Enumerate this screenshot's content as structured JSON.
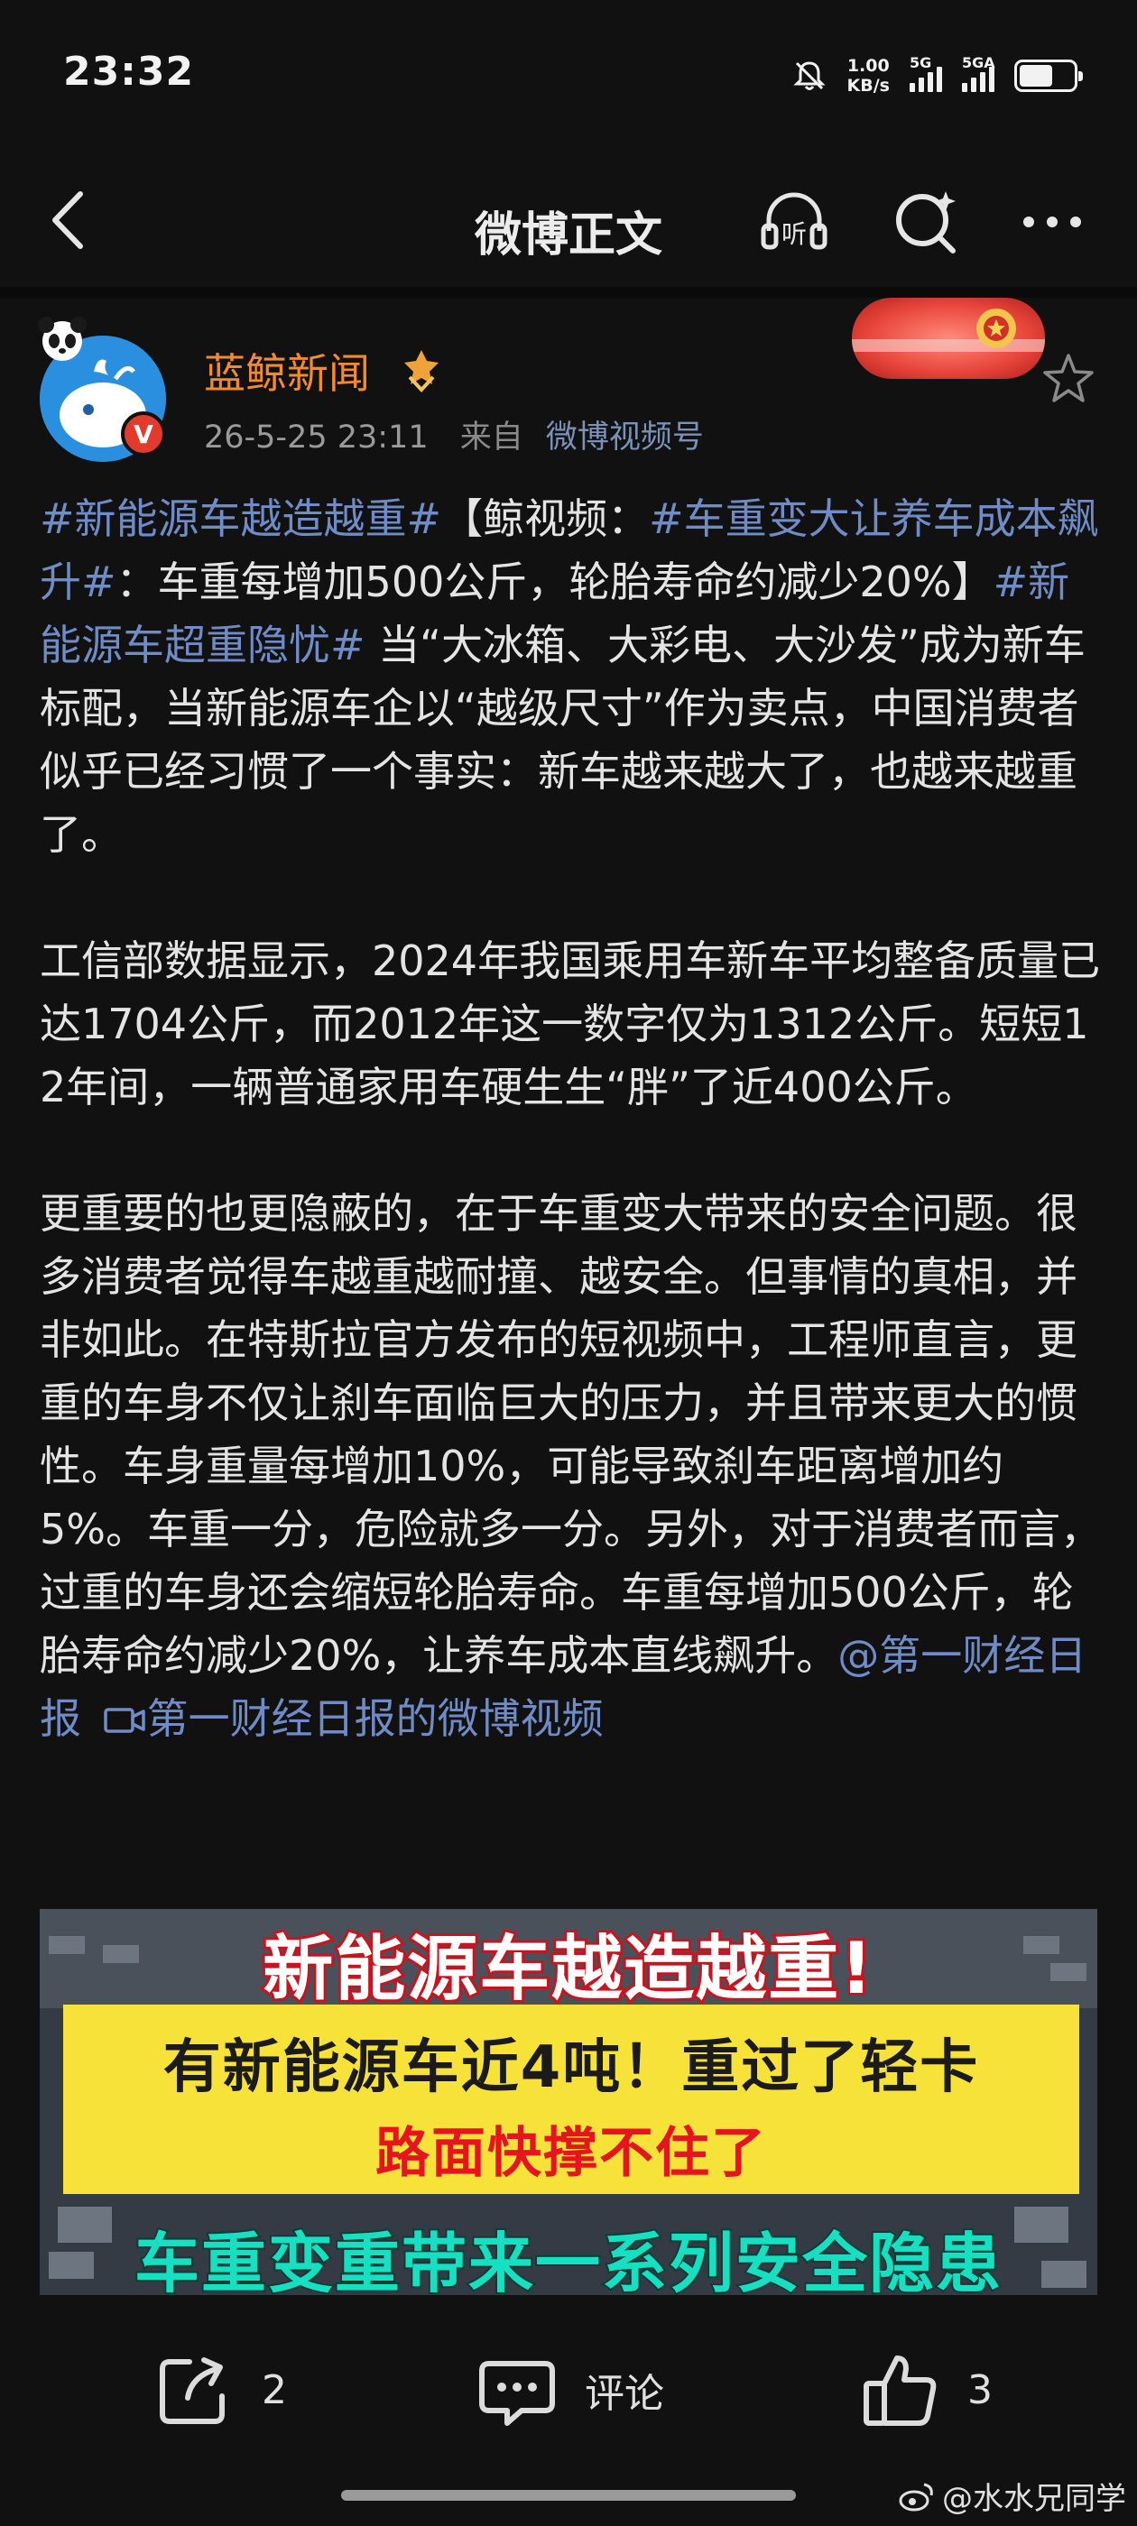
{
  "status": {
    "time": "23:32",
    "net_speed_value": "1.00",
    "net_speed_unit": "KB/s",
    "sim1_label": "5G",
    "sim2_label": "5GA",
    "battery_level": 0.62
  },
  "nav": {
    "title": "微博正文",
    "icons": [
      "back-icon",
      "listen-icon",
      "search-icon",
      "more-icon"
    ]
  },
  "post": {
    "username": "蓝鲸新闻",
    "verified": "V",
    "time": "26-5-25 23:11",
    "source_prefix": "来自",
    "source": "微博视频号",
    "p1": {
      "topic1": "#新能源车越造越重#",
      "t1": "【鲸视频：",
      "topic2": "#车重变大让养车成本飙升#",
      "t2": "：车重每增加500公斤，轮胎寿命约减少20%】",
      "topic3": "#新能源车超重隐忧#",
      "t3": " 当“大冰箱、大彩电、大沙发”成为新车标配，当新能源车企以“越级尺寸”作为卖点，中国消费者似乎已经习惯了一个事实：新车越来越大了，也越来越重了。"
    },
    "p2": "工信部数据显示，2024年我国乘用车新车平均整备质量已达1704公斤，而2012年这一数字仅为1312公斤。短短12年间，一辆普通家用车硬生生“胖”了近400公斤。",
    "p3": {
      "text": "更重要的也更隐蔽的，在于车重变大带来的安全问题。很多消费者觉得车越重越耐撞、越安全。但事情的真相，并非如此。在特斯拉官方发布的短视频中，工程师直言，更重的车身不仅让刹车面临巨大的压力，并且带来更大的惯性。车身重量每增加10%，可能导致刹车距离增加约5%。车重一分，危险就多一分。另外，对于消费者而言，过重的车身还会缩短轮胎寿命。车重每增加500公斤，轮胎寿命约减少20%，让养车成本直线飙升。",
      "mention": "@第一财经日报",
      "video_link": "第一财经日报的微博视频"
    }
  },
  "video": {
    "line1": "新能源车越造越重!",
    "line2": "有新能源车近4吨！重过了轻卡",
    "line3": "路面快撑不住了",
    "line4": "车重变重带来一系列安全隐患"
  },
  "actions": {
    "repost_count": "2",
    "comment_label": "评论",
    "like_count": "3"
  },
  "watermark": "@水水兄同学"
}
